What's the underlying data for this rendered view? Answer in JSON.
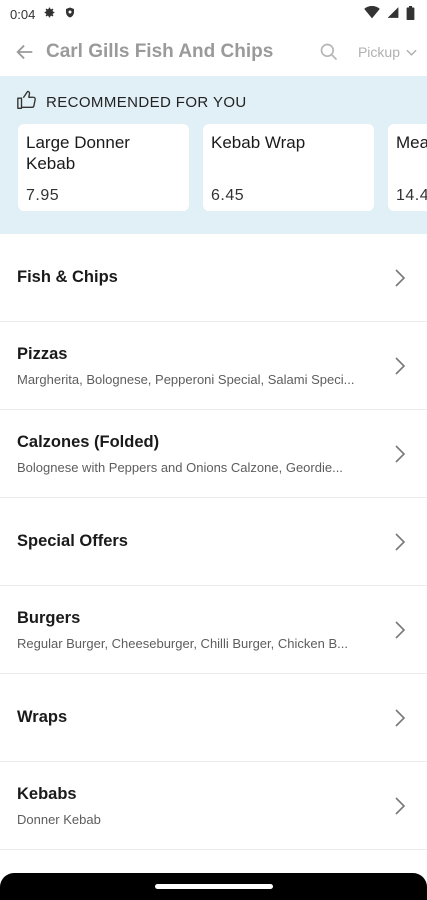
{
  "status_bar": {
    "time": "0:04"
  },
  "header": {
    "title": "Carl Gills Fish And Chips",
    "mode_label": "Pickup"
  },
  "recommended": {
    "title": "RECOMMENDED FOR YOU",
    "items": [
      {
        "name": "Large Donner Kebab",
        "price": "7.95"
      },
      {
        "name": "Kebab Wrap",
        "price": "6.45"
      },
      {
        "name": "Mea",
        "price": "14.4"
      }
    ]
  },
  "categories": [
    {
      "title": "Fish & Chips",
      "subtitle": ""
    },
    {
      "title": "Pizzas",
      "subtitle": "Margherita, Bolognese, Pepperoni Special, Salami Speci..."
    },
    {
      "title": "Calzones (Folded)",
      "subtitle": "Bolognese with Peppers and Onions Calzone, Geordie..."
    },
    {
      "title": "Special Offers",
      "subtitle": ""
    },
    {
      "title": "Burgers",
      "subtitle": "Regular Burger, Cheeseburger, Chilli Burger, Chicken B..."
    },
    {
      "title": "Wraps",
      "subtitle": ""
    },
    {
      "title": "Kebabs",
      "subtitle": "Donner Kebab"
    }
  ]
}
